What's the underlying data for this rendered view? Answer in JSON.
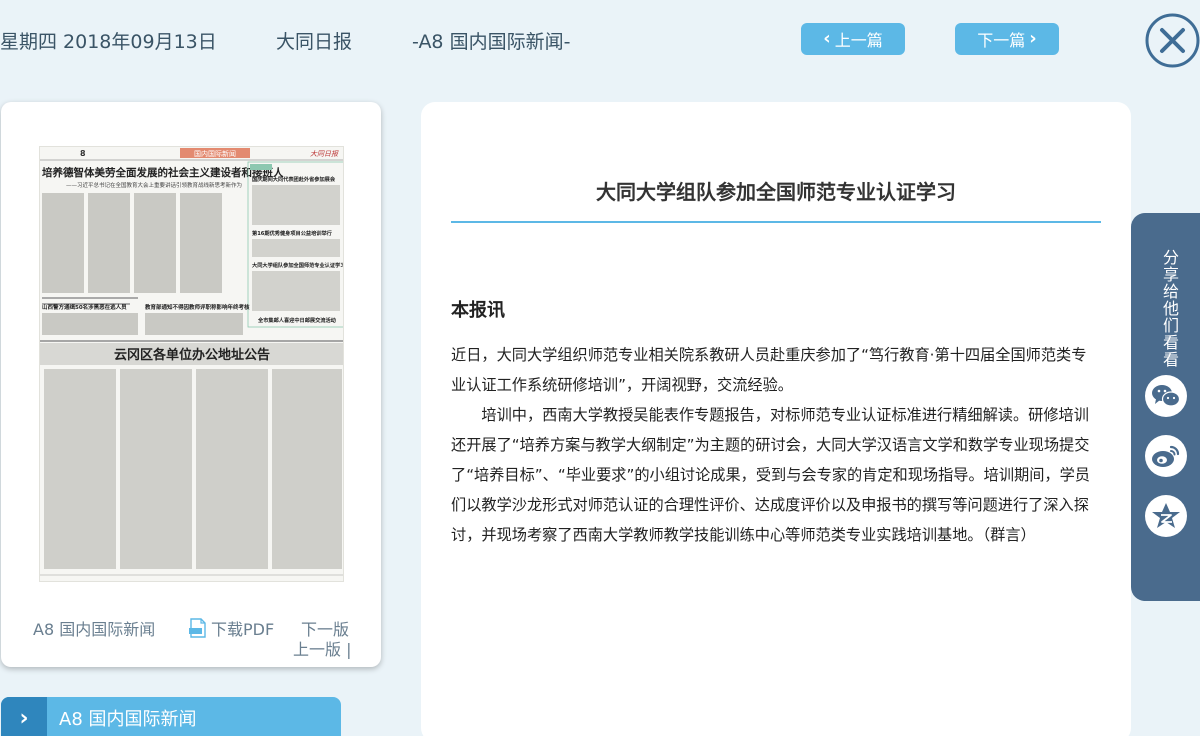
{
  "header": {
    "date": "星期四 2018年09月13日",
    "paper_name": "大同日报",
    "page_label": "-A8 国内国际新闻-",
    "prev_article": "上一篇",
    "next_article": "下一篇",
    "close_icon": "close-icon"
  },
  "page_card": {
    "page_name": "A8 国内国际新闻",
    "download_pdf": "下载PDF",
    "next_page": "下一版",
    "prev_page": "上一版 |",
    "thumbnail": {
      "page_no": "8",
      "section_tag": "国内国际新闻",
      "masthead": "大同日报",
      "headline_main": "培养德智体美劳全面发展的社会主义建设者和接班人",
      "headline_sub": "——习近平总书记在全国教育大会上重要讲话引领教育战线新思考新作为",
      "side_heads": [
        "国庆期间大同代表团赴外省参加展会",
        "第16期优秀健身项目公益培训举行",
        "大同大学组队参加全国师范专业认证学习",
        "全市集邮人喜迎中日邮展交流活动"
      ],
      "mid_heads": [
        "山西警方通缉50名涉黑恶在逃人员",
        "教育部通知不得因教师评职称影响年终考核"
      ],
      "notice_title": "云冈区各单位办公地址公告"
    }
  },
  "section_nav": {
    "label": "A8  国内国际新闻"
  },
  "article": {
    "title": "大同大学组队参加全国师范专业认证学习",
    "source": "本报讯",
    "paragraphs": [
      "近日，大同大学组织师范专业相关院系教研人员赴重庆参加了“笃行教育·第十四届全国师范类专业认证工作系统研修培训”，开阔视野，交流经验。",
      "培训中，西南大学教授吴能表作专题报告，对标师范专业认证标准进行精细解读。研修培训还开展了“培养方案与教学大纲制定”为主题的研讨会，大同大学汉语言文学和数学专业现场提交了“培养目标”、“毕业要求”的小组讨论成果，受到与会专家的肯定和现场指导。培训期间，学员们以教学沙龙形式对师范认证的合理性评价、达成度评价以及申报书的撰写等问题进行了深入探讨，并现场考察了西南大学教师教学技能训练中心等师范类专业实践培训基地。（群言）"
    ]
  },
  "share": {
    "label": "分享给他们看看",
    "icons": [
      "wechat-icon",
      "weibo-icon",
      "qzone-icon"
    ]
  },
  "colors": {
    "background": "#eaf3f8",
    "accent": "#5cb8e6",
    "accent_dark": "#2f86bd",
    "share_panel": "#4a6b8d",
    "close": "#3f6d96"
  }
}
